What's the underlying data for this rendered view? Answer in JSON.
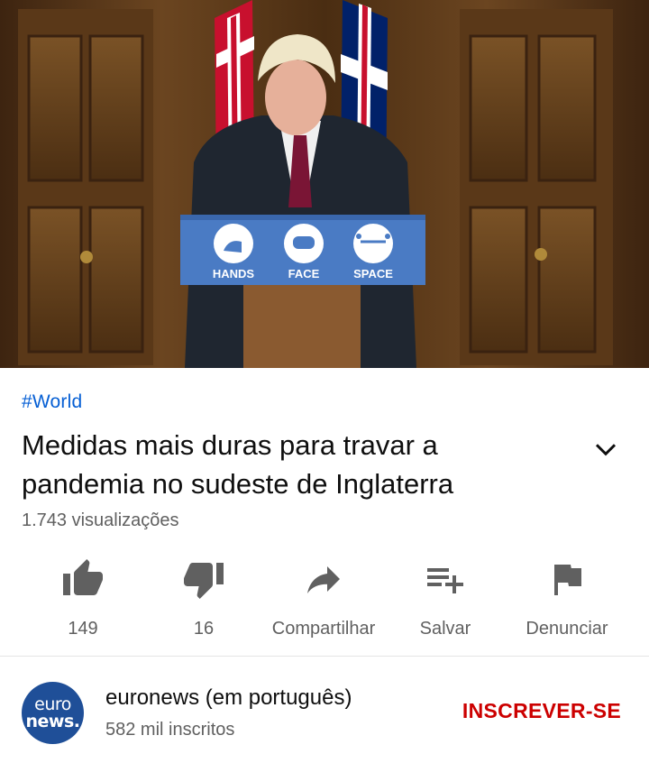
{
  "video": {
    "podium_signs": [
      "HANDS",
      "FACE",
      "SPACE"
    ]
  },
  "meta": {
    "hashtag": "#World",
    "title": "Medidas mais duras para travar a pandemia no sudeste de Inglaterra",
    "views": "1.743 visualizações"
  },
  "actions": [
    {
      "icon": "thumb-up-icon",
      "label": "149"
    },
    {
      "icon": "thumb-down-icon",
      "label": "16"
    },
    {
      "icon": "share-icon",
      "label": "Compartilhar"
    },
    {
      "icon": "playlist-add-icon",
      "label": "Salvar"
    },
    {
      "icon": "flag-icon",
      "label": "Denunciar"
    }
  ],
  "channel": {
    "avatar_line1": "euro",
    "avatar_line2": "news.",
    "name": "euronews (em português)",
    "subscribers": "582 mil inscritos",
    "subscribe_label": "INSCREVER-SE"
  },
  "colors": {
    "link": "#065fd4",
    "subscribe": "#cc0000",
    "secondary_text": "#606060",
    "avatar_bg": "#1f4f98"
  }
}
